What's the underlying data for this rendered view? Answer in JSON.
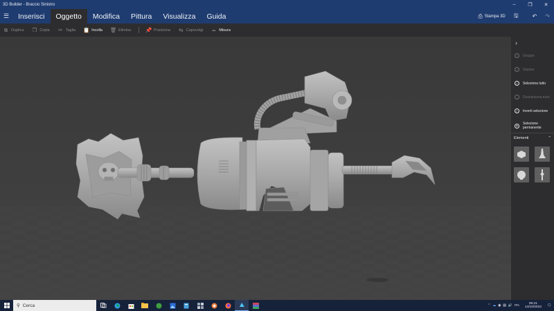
{
  "window": {
    "title": "3D Builder - Braccio Sinistro"
  },
  "ribbon": {
    "tabs": [
      {
        "label": "Inserisci"
      },
      {
        "label": "Oggetto"
      },
      {
        "label": "Modifica"
      },
      {
        "label": "Pittura"
      },
      {
        "label": "Visualizza"
      },
      {
        "label": "Guida"
      }
    ],
    "active_tab": "Oggetto",
    "print_3d_label": "Stampa 3D"
  },
  "toolbar": {
    "duplica": "Duplica",
    "copia": "Copia",
    "taglia": "Taglia",
    "incolla": "Incolla",
    "elimina": "Elimina",
    "posiziona": "Posiziona",
    "capovolgi": "Capovolgi",
    "misura": "Misura"
  },
  "panel": {
    "items": [
      {
        "label": "Gruppo",
        "enabled": false,
        "icon": "group-icon"
      },
      {
        "label": "Separa",
        "enabled": false,
        "icon": "ungroup-icon"
      },
      {
        "label": "Seleziona tutto",
        "enabled": true,
        "icon": "select-all-icon"
      },
      {
        "label": "Deseleziona tutto",
        "enabled": false,
        "icon": "deselect-icon"
      },
      {
        "label": "Inverti selezione",
        "enabled": true,
        "icon": "invert-selection-icon"
      },
      {
        "label": "Selezione permanente",
        "enabled": true,
        "icon": "sticky-selection-icon"
      }
    ],
    "elements_label": "Elementi"
  },
  "taskbar": {
    "search_placeholder": "Cerca",
    "language": "ITA",
    "time": "06:41",
    "date": "14/10/2024"
  },
  "colors": {
    "titlebar": "#1f3c70",
    "toolbar": "#2d2d30",
    "viewport_bg": "#3b3b3b",
    "model": "#a9a9a9",
    "taskbar": "#16213a"
  }
}
